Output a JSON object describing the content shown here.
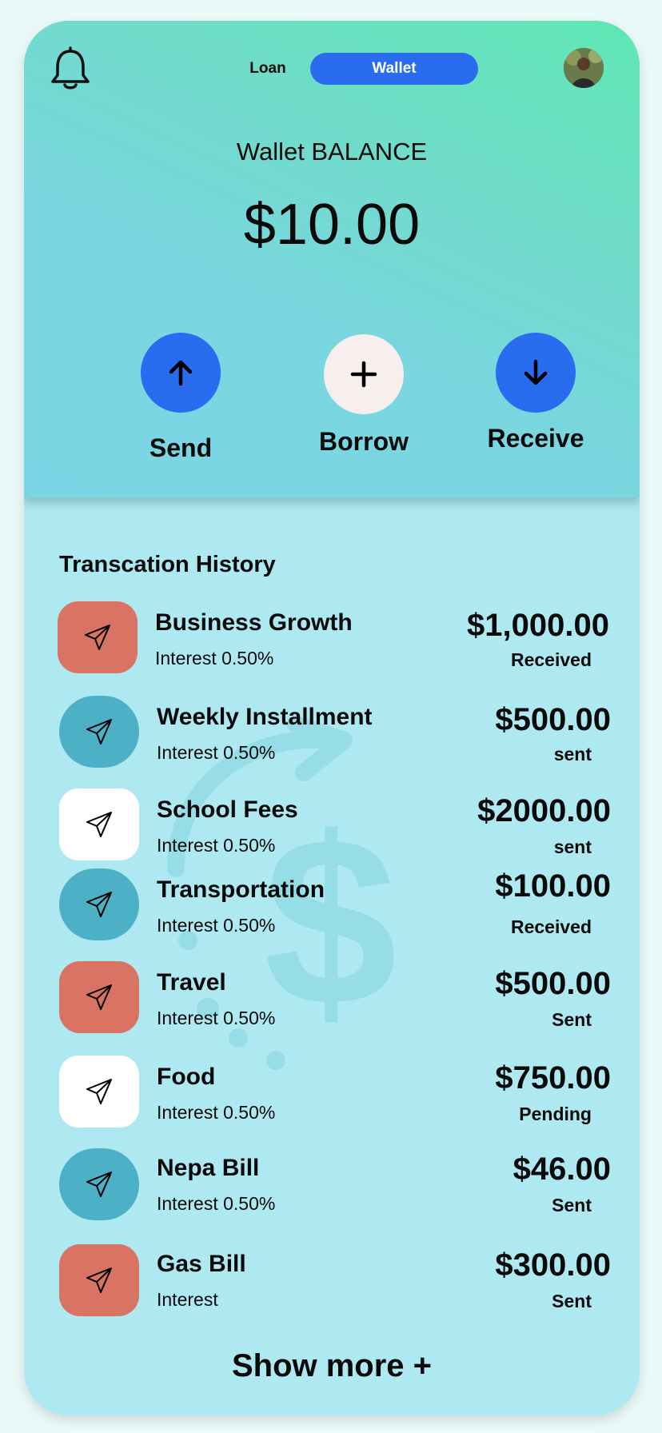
{
  "header": {
    "tabs": [
      {
        "label": "Loan",
        "active": false
      },
      {
        "label": "Wallet",
        "active": true
      }
    ],
    "bell_icon": "bell-icon",
    "avatar": "user-avatar"
  },
  "balance": {
    "label": "Wallet BALANCE",
    "amount": "$10.00"
  },
  "actions": [
    {
      "label": "Send",
      "icon": "arrow-up-icon"
    },
    {
      "label": "Borrow",
      "icon": "plus-icon"
    },
    {
      "label": "Receive",
      "icon": "arrow-down-icon"
    }
  ],
  "history": {
    "title": "Transcation History",
    "items": [
      {
        "title": "Business Growth",
        "subtitle": "Interest 0.50%",
        "amount": "$1,000.00",
        "status": "Received",
        "color": "#d97465"
      },
      {
        "title": "Weekly Installment",
        "subtitle": "Interest  0.50%",
        "amount": "$500.00",
        "status": "sent",
        "color": "#4cb1c6"
      },
      {
        "title": "School Fees",
        "subtitle": "Interest  0.50%",
        "amount": "$2000.00",
        "status": "sent",
        "color": "#ffffff"
      },
      {
        "title": "Transportation",
        "subtitle": "Interest  0.50%",
        "amount": "$100.00",
        "status": "Received",
        "color": "#4cb1c6"
      },
      {
        "title": "Travel",
        "subtitle": "Interest  0.50%",
        "amount": "$500.00",
        "status": "Sent",
        "color": "#d97465"
      },
      {
        "title": "Food",
        "subtitle": "Interest  0.50%",
        "amount": "$750.00",
        "status": "Pending",
        "color": "#ffffff"
      },
      {
        "title": "Nepa Bill",
        "subtitle": "Interest   0.50%",
        "amount": "$46.00",
        "status": "Sent",
        "color": "#4cb1c6"
      },
      {
        "title": "Gas Bill",
        "subtitle": "Interest",
        "amount": "$300.00",
        "status": "Sent",
        "color": "#d97465"
      }
    ],
    "show_more": "Show more +"
  },
  "colors": {
    "accent_blue": "#2a6cf0",
    "red": "#d97465",
    "teal": "#4cb1c6"
  }
}
